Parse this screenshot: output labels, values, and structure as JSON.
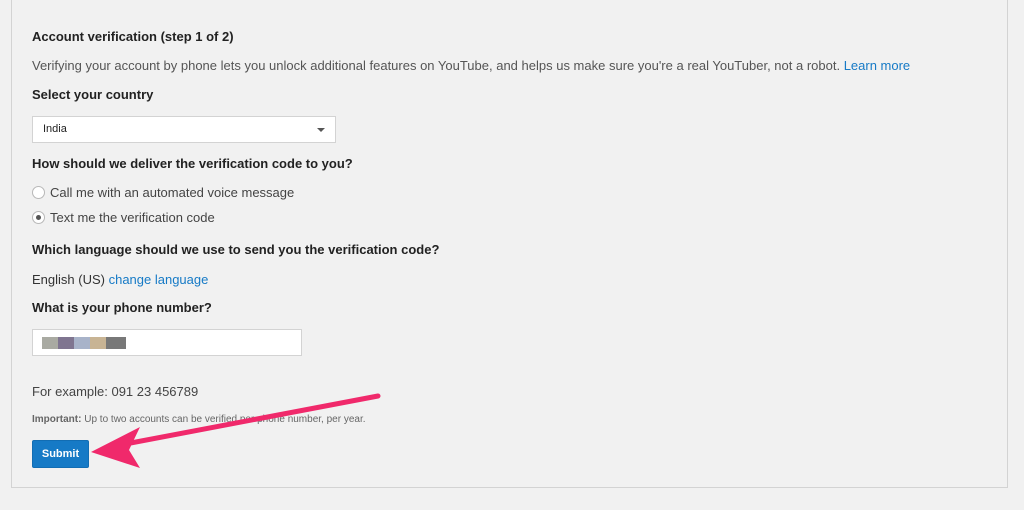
{
  "section_title": "Account verification (step 1 of 2)",
  "intro": {
    "text": "Verifying your account by phone lets you unlock additional features on YouTube, and helps us make sure you're a real YouTuber, not a robot.",
    "learn_more": "Learn more"
  },
  "country": {
    "label": "Select your country",
    "selected": "India"
  },
  "delivery": {
    "label": "How should we deliver the verification code to you?",
    "options": [
      {
        "label": "Call me with an automated voice message",
        "checked": false
      },
      {
        "label": "Text me the verification code",
        "checked": true
      }
    ]
  },
  "language": {
    "label": "Which language should we use to send you the verification code?",
    "current": "English (US)",
    "change_link": "change language"
  },
  "phone": {
    "label": "What is your phone number?",
    "redacted_colors": [
      "#a9aaa2",
      "#7f7590",
      "#a8b3c9",
      "#c8b494",
      "#787878"
    ],
    "example": "For example: 091 23 456789"
  },
  "note": {
    "bold": "Important:",
    "text": " Up to two accounts can be verified per phone number, per year."
  },
  "submit_label": "Submit",
  "colors": {
    "accent": "#167ac6",
    "annotation_arrow": "#f0296b"
  }
}
